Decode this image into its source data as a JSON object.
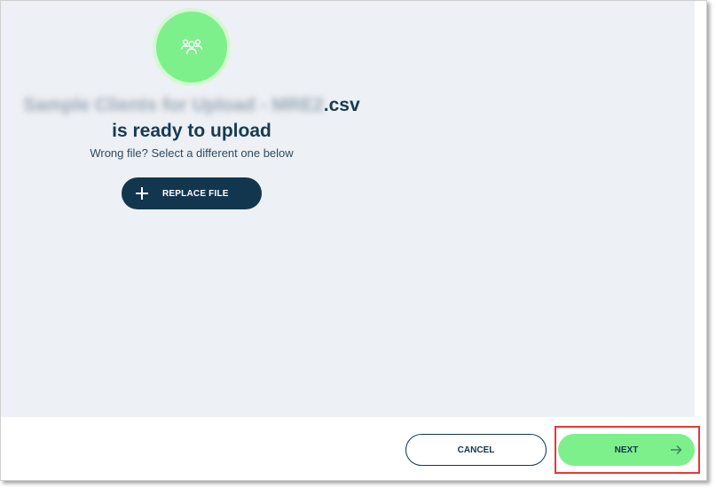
{
  "upload": {
    "file_name_blurred": "Sample Clients for Upload - MRE2",
    "file_extension": ".csv",
    "ready_title": "is ready to upload",
    "hint": "Wrong file? Select a different one below",
    "icon": "users-group-icon",
    "replace_label": "REPLACE FILE"
  },
  "footer": {
    "cancel_label": "CANCEL",
    "next_label": "NEXT",
    "next_icon": "arrow-right-icon"
  },
  "colors": {
    "accent_green": "#7df08c",
    "navy": "#12364e",
    "panel_bg": "#edf0f4",
    "highlight": "#e53935"
  }
}
